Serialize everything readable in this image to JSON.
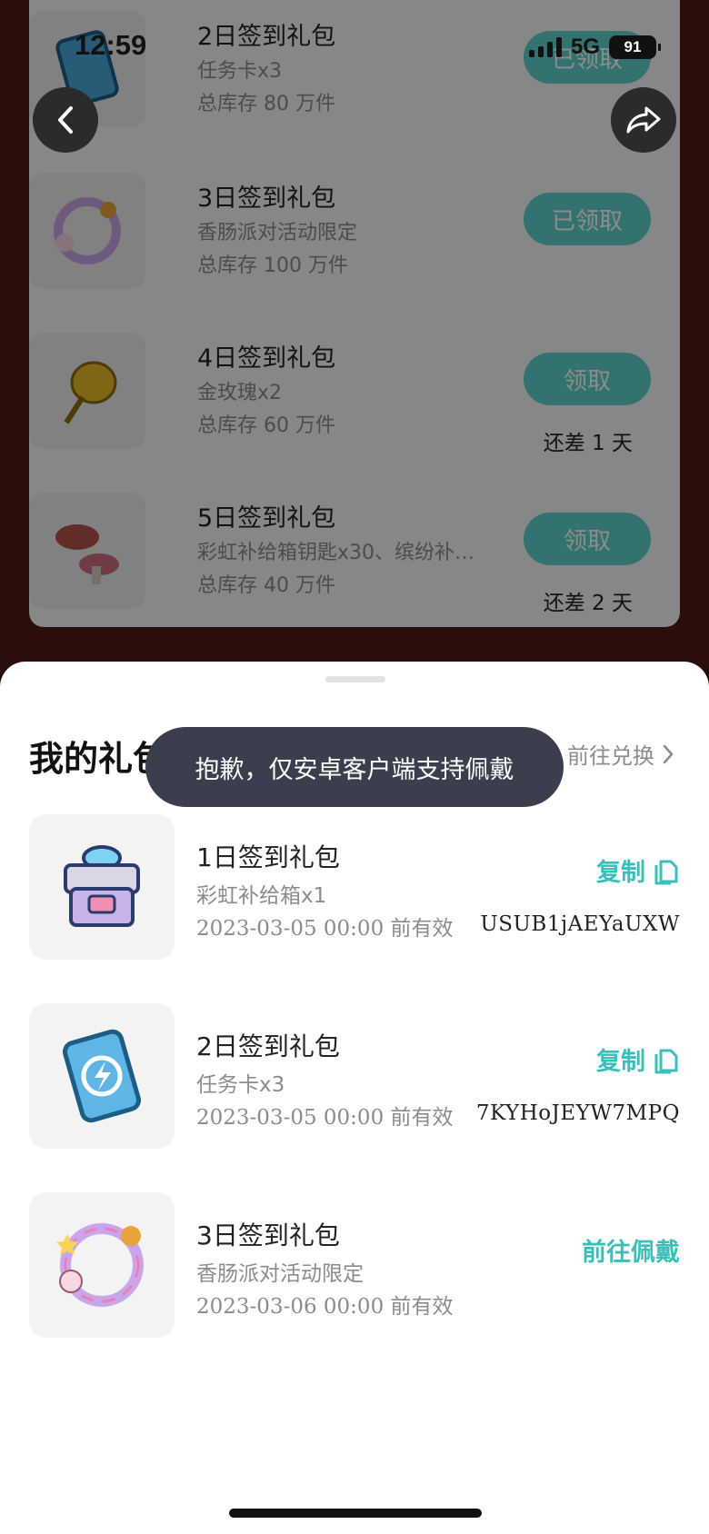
{
  "status_bar": {
    "time": "12:59",
    "network": "5G",
    "battery": "91"
  },
  "background_list": [
    {
      "title": "2日签到礼包",
      "item": "任务卡x3",
      "stock": "总库存 80 万件",
      "button": "已领取",
      "remain": ""
    },
    {
      "title": "3日签到礼包",
      "item": "香肠派对活动限定",
      "stock": "总库存 100 万件",
      "button": "已领取",
      "remain": ""
    },
    {
      "title": "4日签到礼包",
      "item": "金玫瑰x2",
      "stock": "总库存 60 万件",
      "button": "领取",
      "remain": "还差 1 天"
    },
    {
      "title": "5日签到礼包",
      "item": "彩虹补给箱钥匙x30、缤纷补…",
      "stock": "总库存 40 万件",
      "button": "领取",
      "remain": "还差 2 天"
    }
  ],
  "sheet": {
    "title": "我的礼包",
    "redeem_link": "前往兑换",
    "gifts": [
      {
        "title": "1日签到礼包",
        "item": "彩虹补给箱x1",
        "valid": "2023-03-05 00:00 前有效",
        "action": "复制",
        "code": "USUB1jAEYaUXW"
      },
      {
        "title": "2日签到礼包",
        "item": "任务卡x3",
        "valid": "2023-03-05 00:00 前有效",
        "action": "复制",
        "code": "7KYHoJEYW7MPQ"
      },
      {
        "title": "3日签到礼包",
        "item": "香肠派对活动限定",
        "valid": "2023-03-06 00:00 前有效",
        "action": "前往佩戴",
        "code": ""
      }
    ]
  },
  "toast": "抱歉，仅安卓客户端支持佩戴",
  "icons": {
    "back": "chevron-left-icon",
    "share": "share-icon",
    "copy": "copy-icon",
    "redeem_arrow": "chevron-right-icon"
  },
  "colors": {
    "accent": "#3bbfb8",
    "button_bg": "#5dd0c9",
    "toast_bg": "#3b3f4d",
    "page_bg": "#4d1a14"
  }
}
